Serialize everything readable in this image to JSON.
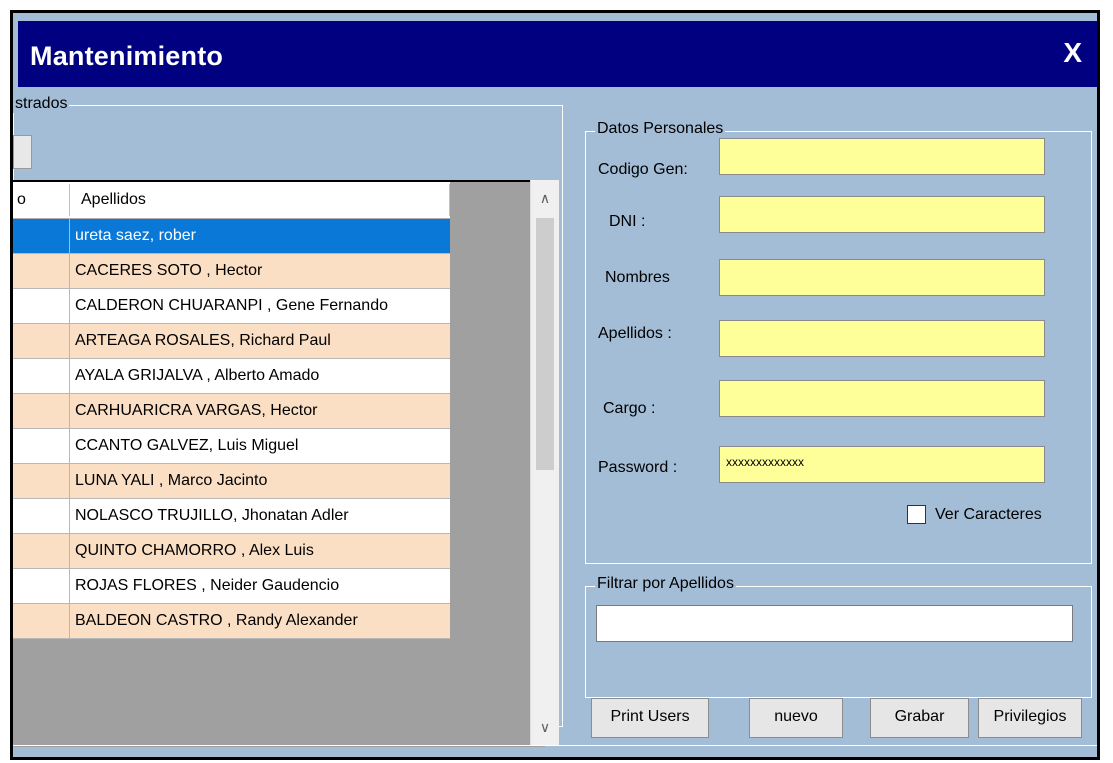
{
  "window": {
    "title": "Mantenimiento",
    "close_label": "X"
  },
  "left_group": {
    "legend": "strados"
  },
  "grid": {
    "columns": [
      "o",
      "Apellidos"
    ],
    "rows": [
      {
        "apellidos": "ureta saez, rober",
        "selected": true
      },
      {
        "apellidos": "CACERES SOTO , Hector"
      },
      {
        "apellidos": "CALDERON CHUARANPI , Gene Fernando"
      },
      {
        "apellidos": "ARTEAGA ROSALES,  Richard Paul"
      },
      {
        "apellidos": "AYALA GRIJALVA , Alberto Amado"
      },
      {
        "apellidos": "CARHUARICRA VARGAS,  Hector"
      },
      {
        "apellidos": "CCANTO GALVEZ,  Luis Miguel"
      },
      {
        "apellidos": "LUNA YALI , Marco Jacinto"
      },
      {
        "apellidos": "NOLASCO TRUJILLO,  Jhonatan Adler"
      },
      {
        "apellidos": "QUINTO CHAMORRO , Alex Luis"
      },
      {
        "apellidos": "ROJAS FLORES , Neider Gaudencio"
      },
      {
        "apellidos": "BALDEON CASTRO ,  Randy Alexander"
      }
    ]
  },
  "scrollbar": {
    "up_icon": "chevron-up-icon",
    "down_icon": "chevron-down-icon"
  },
  "datos_personales": {
    "legend": "Datos Personales",
    "codigo_gen_label": "Codigo Gen:",
    "dni_label": "DNI :",
    "nombres_label": "Nombres",
    "apellidos_label": "Apellidos :",
    "cargo_label": "Cargo :",
    "password_label": "Password :",
    "codigo_gen_value": "",
    "dni_value": "",
    "nombres_value": "",
    "apellidos_value": "",
    "cargo_value": "",
    "password_value": "xxxxxxxxxxxxx",
    "ver_caracteres_label": "Ver Caracteres"
  },
  "filtro": {
    "legend": "Filtrar por Apellidos",
    "value": ""
  },
  "buttons": {
    "print_users": "Print Users",
    "nuevo": "nuevo",
    "grabar": "Grabar",
    "privilegios": "Privilegios"
  },
  "colors": {
    "title_bar": "#000080",
    "window_bg": "#a3bdd6",
    "row_alt": "#fbdfc4",
    "row_selected": "#0a78d7",
    "field_bg": "#ffff99"
  }
}
